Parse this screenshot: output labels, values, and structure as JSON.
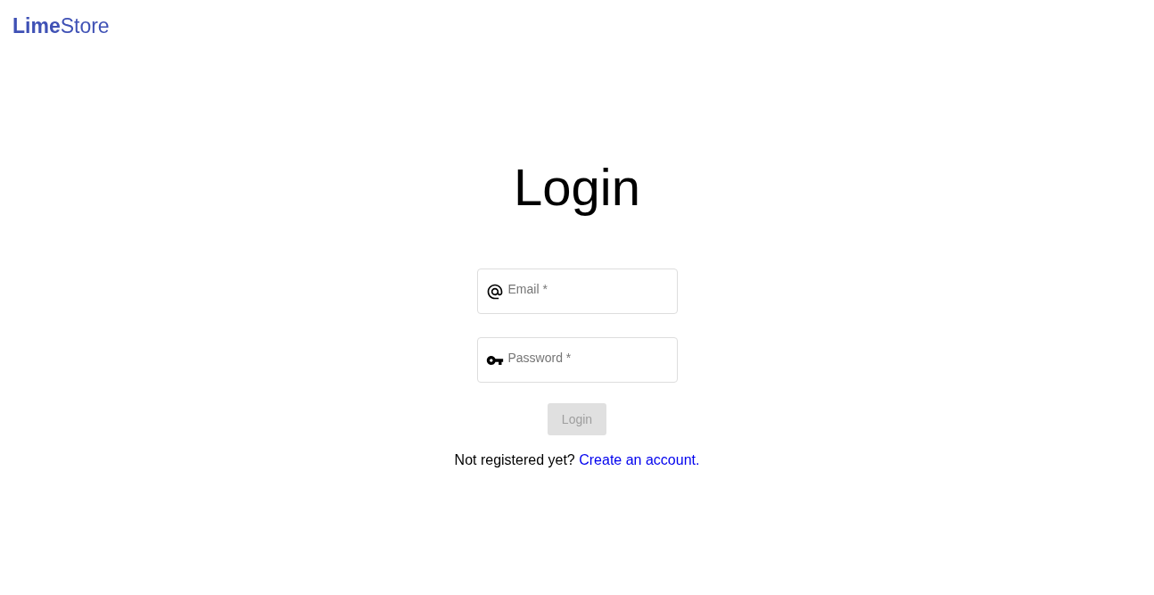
{
  "logo": "**Lime**Store",
  "title": "Login",
  "fields": [
    {
      "kind": "email",
      "placeholder": "Email *"
    },
    {
      "kind": "password",
      "placeholder": "Password *"
    }
  ],
  "login_button": {
    "label": "Login",
    "disabled": true
  },
  "footer": {
    "text": "Not registered yet?",
    "link": "Create an account."
  }
}
